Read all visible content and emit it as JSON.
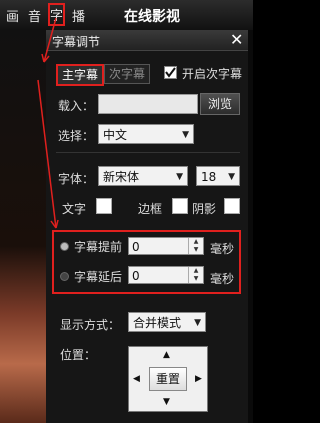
{
  "menubar": {
    "items": [
      "画",
      "音",
      "字",
      "播"
    ],
    "title": "在线影视"
  },
  "panel": {
    "title": "字幕调节",
    "close": "✕",
    "tabs": {
      "main": "主字幕",
      "secondary": "次字幕"
    },
    "enable_secondary": {
      "label": "开启次字幕",
      "checked": true
    },
    "load": {
      "label": "载入：",
      "value": "",
      "browse": "浏览"
    },
    "choose": {
      "label": "选择：",
      "value": "中文"
    },
    "font": {
      "label": "字体：",
      "value": "新宋体",
      "size": "18"
    },
    "text_color": {
      "label": "文字"
    },
    "border": {
      "label": "边框"
    },
    "shadow": {
      "label": "阴影"
    },
    "sync": {
      "advance": {
        "label": "字幕提前",
        "value": "0",
        "unit": "毫秒"
      },
      "delay": {
        "label": "字幕延后",
        "value": "0",
        "unit": "毫秒"
      }
    },
    "display_mode": {
      "label": "显示方式：",
      "value": "合并模式"
    },
    "position": {
      "label": "位置：",
      "reset": "重置",
      "arrows": [
        "▲",
        "▼",
        "◀",
        "▶"
      ]
    }
  },
  "colors": {
    "highlight": "#e0201e",
    "panel_bg": "#161616"
  }
}
